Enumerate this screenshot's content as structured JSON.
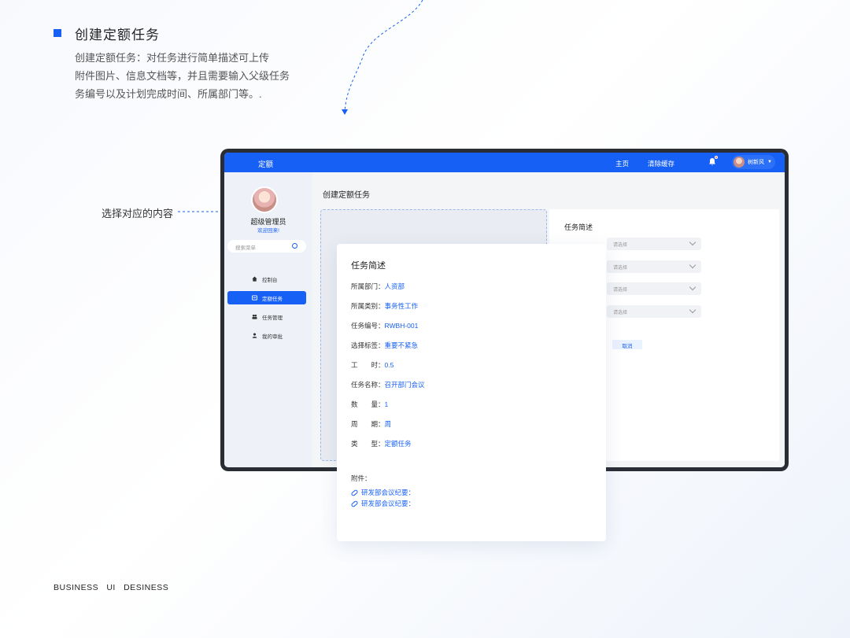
{
  "header": {
    "title": "创建定额任务",
    "desc_line1": "创建定额任务：对任务进行简单描述可上传",
    "desc_line2": "附件图片、信息文档等，并且需要输入父级任务",
    "desc_line3": "务编号以及计划完成时间、所属部门等。."
  },
  "callout": "选择对应的内容",
  "footer": "BUSINESS   UI   DESINESS",
  "app": {
    "brand": "定额",
    "nav": [
      "主页",
      "清除缓存"
    ],
    "user": "树新风",
    "sidebar": {
      "name": "超级管理员",
      "welcome": "欢迎回来!",
      "search_placeholder": "搜索菜单",
      "items": [
        {
          "label": "控制台",
          "icon": "home-icon"
        },
        {
          "label": "定额任务",
          "icon": "task-icon",
          "active": true
        },
        {
          "label": "任务管理",
          "icon": "users-icon"
        },
        {
          "label": "我的审批",
          "icon": "user-icon"
        }
      ]
    },
    "page_title": "创建定额任务",
    "form": {
      "title": "任务简述",
      "select_placeholder": "请选择",
      "cancel": "取消"
    }
  },
  "card": {
    "title": "任务简述",
    "rows": [
      {
        "label": "所属部门：",
        "value": "人资部"
      },
      {
        "label": "所属类别：",
        "value": "事务性工作"
      },
      {
        "label": "任务编号：",
        "value": "RWBH-001"
      },
      {
        "label": "选择标签：",
        "value": "重要不紧急"
      },
      {
        "label": "工　　时：",
        "value": "0.5"
      },
      {
        "label": "任务名称：",
        "value": "召开部门会议"
      },
      {
        "label": "数　　量：",
        "value": "1"
      },
      {
        "label": "周　　期：",
        "value": "周"
      },
      {
        "label": "类　　型：",
        "value": "定额任务"
      }
    ],
    "attach_label": "附件：",
    "attachments": [
      "研发部会议纪要：",
      "研发部会议纪要："
    ]
  },
  "colors": {
    "accent": "#1760f5"
  }
}
